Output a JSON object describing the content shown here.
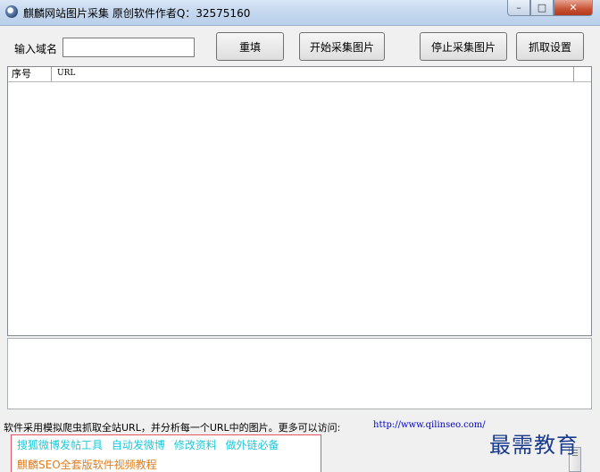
{
  "window": {
    "title": "麒麟网站图片采集 原创软件作者Q：32575160",
    "minimize_glyph": "–",
    "maximize_glyph": "□",
    "close_glyph": "✕"
  },
  "toolbar": {
    "domain_label": "输入域名",
    "domain_value": "",
    "reset_label": "重填",
    "start_label": "开始采集图片",
    "stop_label": "停止采集图片",
    "settings_label": "抓取设置"
  },
  "table": {
    "columns": [
      "序号",
      "URL"
    ],
    "rows": []
  },
  "info": {
    "text": "软件采用模拟爬虫抓取全站URL，并分析每一个URL中的图片。更多可以访问:",
    "link": "http://www.qilinseo.com/"
  },
  "promo": {
    "links": [
      "搜狐微博发帖工具",
      "自动发微博",
      "修改资料",
      "做外链必备"
    ],
    "line2": "麒麟SEO全套版软件视频教程"
  },
  "watermark": "最需教育",
  "colors": {
    "promo_link": "#1bc9d9",
    "promo_line2": "#e07d1c",
    "promo_border": "#e0566b",
    "info_link": "#0000cc",
    "watermark": "#1a3b8c"
  }
}
